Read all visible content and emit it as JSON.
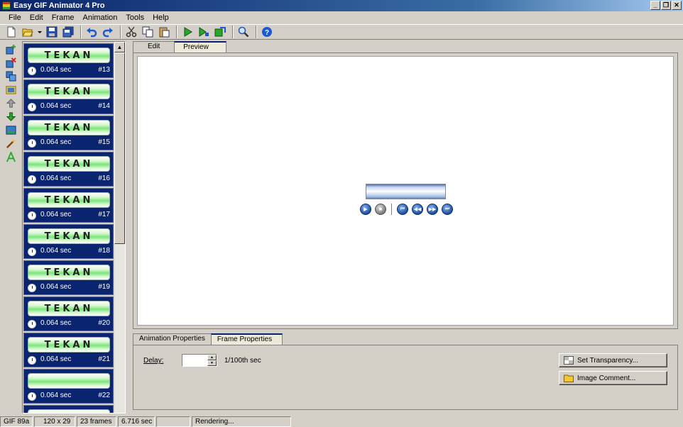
{
  "window": {
    "title": "Easy GIF Animator 4 Pro"
  },
  "menu": [
    "File",
    "Edit",
    "Frame",
    "Animation",
    "Tools",
    "Help"
  ],
  "toolbar_icons": [
    "new-icon",
    "open-icon",
    "dropdown-icon",
    "save-icon",
    "save-all-icon",
    "undo-icon",
    "redo-icon",
    "cut-icon",
    "copy-icon",
    "paste-icon",
    "play-icon",
    "preview-in-browser-icon",
    "export-icon",
    "zoom-icon",
    "help-icon"
  ],
  "side_tools": [
    "insert-frame-icon",
    "delete-frame-icon",
    "duplicate-frame-icon",
    "frame-properties-icon",
    "move-up-icon",
    "move-down-icon",
    "insert-image-icon",
    "magic-wand-icon",
    "text-icon"
  ],
  "frames": [
    {
      "thumb_text": "TEKAN",
      "time": "0.064 sec",
      "num": "#13"
    },
    {
      "thumb_text": "TEKAN",
      "time": "0.064 sec",
      "num": "#14"
    },
    {
      "thumb_text": "TEKAN",
      "time": "0.064 sec",
      "num": "#15"
    },
    {
      "thumb_text": "TEKAN",
      "time": "0.064 sec",
      "num": "#16"
    },
    {
      "thumb_text": "TEKAN",
      "time": "0.064 sec",
      "num": "#17"
    },
    {
      "thumb_text": "TEKAN",
      "time": "0.064 sec",
      "num": "#18"
    },
    {
      "thumb_text": "TEKAN",
      "time": "0.064 sec",
      "num": "#19"
    },
    {
      "thumb_text": "TEKAN",
      "time": "0.064 sec",
      "num": "#20"
    },
    {
      "thumb_text": "TEKAN",
      "time": "0.064 sec",
      "num": "#21"
    },
    {
      "thumb_text": "",
      "time": "0.064 sec",
      "num": "#22"
    }
  ],
  "editor_tabs": {
    "edit": "Edit",
    "preview": "Preview"
  },
  "player_buttons": [
    "play-icon",
    "stop-icon",
    "first-frame-icon",
    "previous-frame-icon",
    "next-frame-icon",
    "last-frame-icon"
  ],
  "props_tabs": {
    "animation": "Animation Properties",
    "frame": "Frame Properties"
  },
  "frame_props": {
    "delay_label": "Delay:",
    "delay_value": "",
    "delay_unit": "1/100th sec",
    "set_transparency": "Set Transparency...",
    "image_comment": "Image Comment..."
  },
  "status": {
    "format": "GIF 89a",
    "size": "120 x 29",
    "frames": "23 frames",
    "duration": "6.716 sec",
    "blank": "",
    "message": "Rendering..."
  }
}
